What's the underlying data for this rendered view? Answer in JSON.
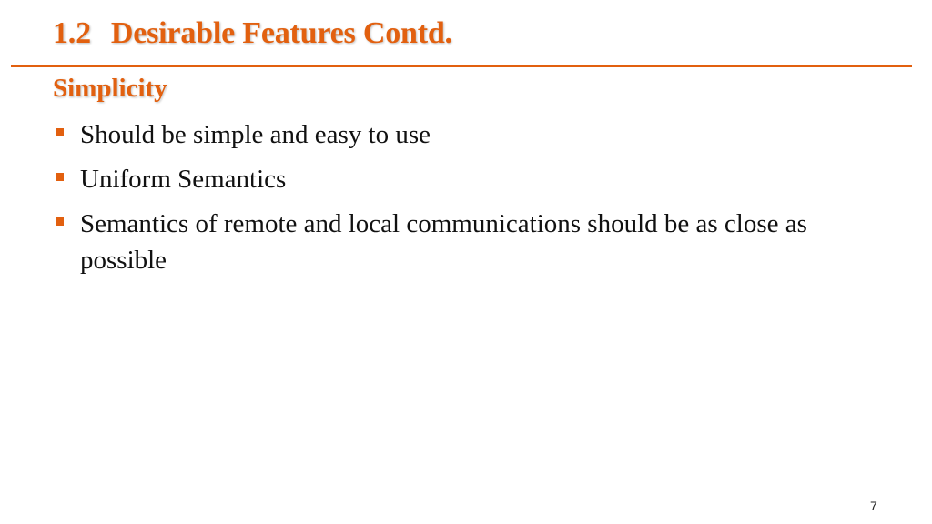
{
  "slide": {
    "title_number": "1.2",
    "title_text": "Desirable Features Contd.",
    "subtitle": "Simplicity",
    "bullets": [
      {
        "text": "Should be simple and easy to use"
      },
      {
        "text": "Uniform Semantics"
      },
      {
        "text": "Semantics of remote and local communications should be as close as possible"
      }
    ],
    "page_number": "7"
  },
  "colors": {
    "accent": "#e2600f",
    "body_text": "#111111"
  }
}
